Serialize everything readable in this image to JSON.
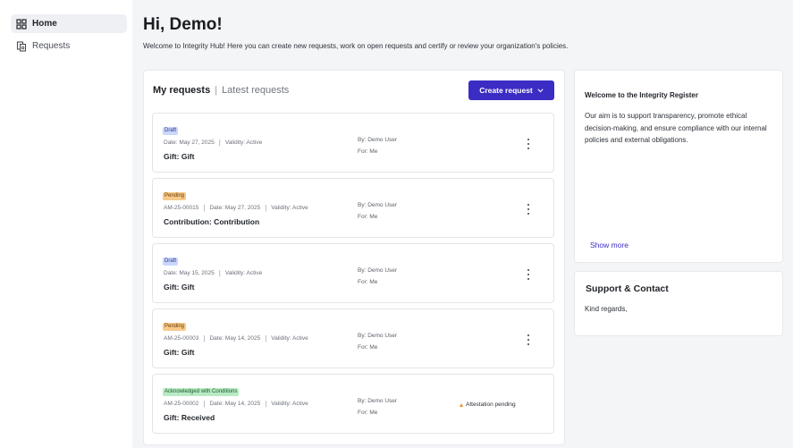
{
  "sidebar": {
    "items": [
      {
        "label": "Home",
        "icon": "dashboard-grid-icon",
        "active": true
      },
      {
        "label": "Requests",
        "icon": "document-stack-icon",
        "active": false
      }
    ]
  },
  "header": {
    "greeting": "Hi, Demo!",
    "welcome": "Welcome to Integrity Hub! Here you can create new requests, work on open requests and certify or review your organization's policies."
  },
  "requests_panel": {
    "tab_active": "My requests",
    "tab_separator": "|",
    "tab_inactive": "Latest requests",
    "create_button": "Create request",
    "cards": [
      {
        "status": "Draft",
        "id": "",
        "date": "Date: May 27, 2025",
        "validity": "Validity: Active",
        "title": "Gift: Gift",
        "by": "By: Demo User",
        "for": "For: Me",
        "note": ""
      },
      {
        "status": "Pending",
        "id": "AM-25-00015",
        "date": "Date: May 27, 2025",
        "validity": "Validity: Active",
        "title": "Contribution: Contribution",
        "by": "By: Demo User",
        "for": "For: Me",
        "note": ""
      },
      {
        "status": "Draft",
        "id": "",
        "date": "Date: May 15, 2025",
        "validity": "Validity: Active",
        "title": "Gift: Gift",
        "by": "By: Demo User",
        "for": "For: Me",
        "note": ""
      },
      {
        "status": "Pending",
        "id": "AM-25-00003",
        "date": "Date: May 14, 2025",
        "validity": "Validity: Active",
        "title": "Gift: Gift",
        "by": "By: Demo User",
        "for": "For: Me",
        "note": ""
      },
      {
        "status": "Acknowledged with Conditions",
        "id": "AM-25-00002",
        "date": "Date: May 14, 2025",
        "validity": "Validity: Active",
        "title": "Gift: Received",
        "by": "By: Demo User",
        "for": "For: Me",
        "note": "Attestation pending"
      }
    ]
  },
  "info_card": {
    "title": "Welcome to the Integrity Register",
    "body": "Our aim is to support transparency, promote ethical decision-making, and ensure compliance with our internal policies and external obligations.",
    "show_more": "Show more"
  },
  "support_card": {
    "title": "Support & Contact",
    "body": "Kind regards,"
  },
  "colors": {
    "primary": "#3b2cc4",
    "draft_badge": "#cad6fb",
    "pending_badge": "#f7c98a",
    "acknowledged_badge": "#b8ebc4",
    "warning": "#f08c1c"
  }
}
